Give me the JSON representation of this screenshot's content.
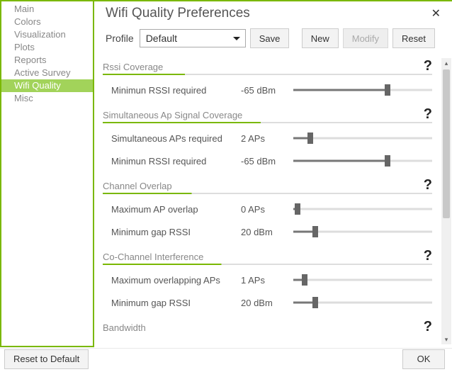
{
  "title": "Wifi Quality Preferences",
  "close_glyph": "✕",
  "sidebar": {
    "items": [
      {
        "label": "Main"
      },
      {
        "label": "Colors"
      },
      {
        "label": "Visualization"
      },
      {
        "label": "Plots"
      },
      {
        "label": "Reports"
      },
      {
        "label": "Active Survey"
      },
      {
        "label": "Wifi Quality"
      },
      {
        "label": "Misc"
      }
    ]
  },
  "profile": {
    "label": "Profile",
    "selected": "Default",
    "save": "Save",
    "new": "New",
    "modify": "Modify",
    "reset": "Reset"
  },
  "sections": {
    "rssi": {
      "title": "Rssi Coverage",
      "min_rssi_label": "Minimun RSSI required",
      "min_rssi_value": "-65 dBm"
    },
    "simul": {
      "title": "Simultaneous Ap Signal Coverage",
      "aps_label": "Simultaneous APs required",
      "aps_value": "2 APs",
      "min_rssi_label": "Minimun RSSI required",
      "min_rssi_value": "-65 dBm"
    },
    "overlap": {
      "title": "Channel Overlap",
      "max_ap_label": "Maximum AP overlap",
      "max_ap_value": "0 APs",
      "gap_label": "Minimum gap RSSI",
      "gap_value": "20 dBm"
    },
    "cochan": {
      "title": "Co-Channel Interference",
      "max_ap_label": "Maximum overlapping APs",
      "max_ap_value": "1 APs",
      "gap_label": "Minimum gap RSSI",
      "gap_value": "20 dBm"
    },
    "bandwidth": {
      "title": "Bandwidth"
    }
  },
  "help_glyph": "?",
  "footer": {
    "reset_default": "Reset to Default",
    "ok": "OK"
  }
}
